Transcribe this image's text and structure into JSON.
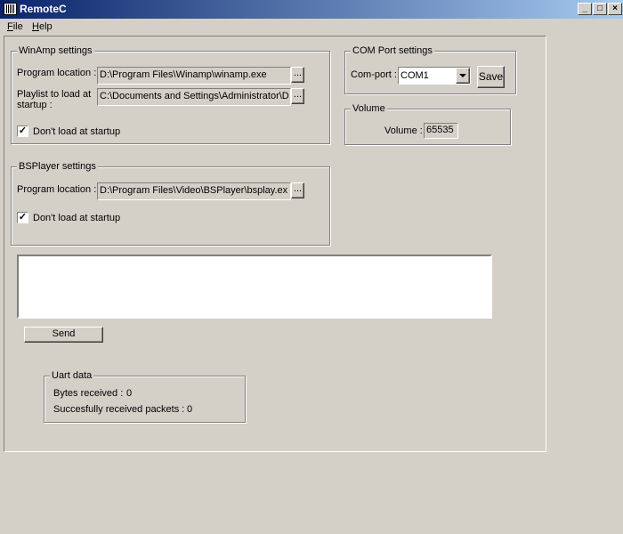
{
  "window": {
    "title": "RemoteC",
    "min_glyph": "_",
    "max_glyph": "□",
    "close_glyph": "×"
  },
  "menu": {
    "file": "File",
    "help": "Help"
  },
  "winamp": {
    "title": "WinAmp settings",
    "program_label": "Program location :",
    "program_value": "D:\\Program Files\\Winamp\\winamp.exe",
    "playlist_label": "Playlist to load at startup :",
    "playlist_value": "C:\\Documents and Settings\\Administrator\\D",
    "browse": "...",
    "dont_load": "Don't load at startup",
    "dont_load_checked": true
  },
  "com": {
    "title": "COM Port settings",
    "port_label": "Com-port :",
    "port_value": "COM1",
    "save": "Save"
  },
  "volume": {
    "title": "Volume",
    "label": "Volume :",
    "value": "65535"
  },
  "bsplayer": {
    "title": "BSPlayer settings",
    "program_label": "Program location :",
    "program_value": "D:\\Program Files\\Video\\BSPlayer\\bsplay.ex",
    "browse": "...",
    "dont_load": "Don't load at startup",
    "dont_load_checked": true
  },
  "send_box": {
    "value": ""
  },
  "send": "Send",
  "uart": {
    "title": "Uart data",
    "bytes_label": "Bytes received :",
    "bytes_value": "0",
    "packets_label": "Succesfully received packets :",
    "packets_value": "0"
  }
}
